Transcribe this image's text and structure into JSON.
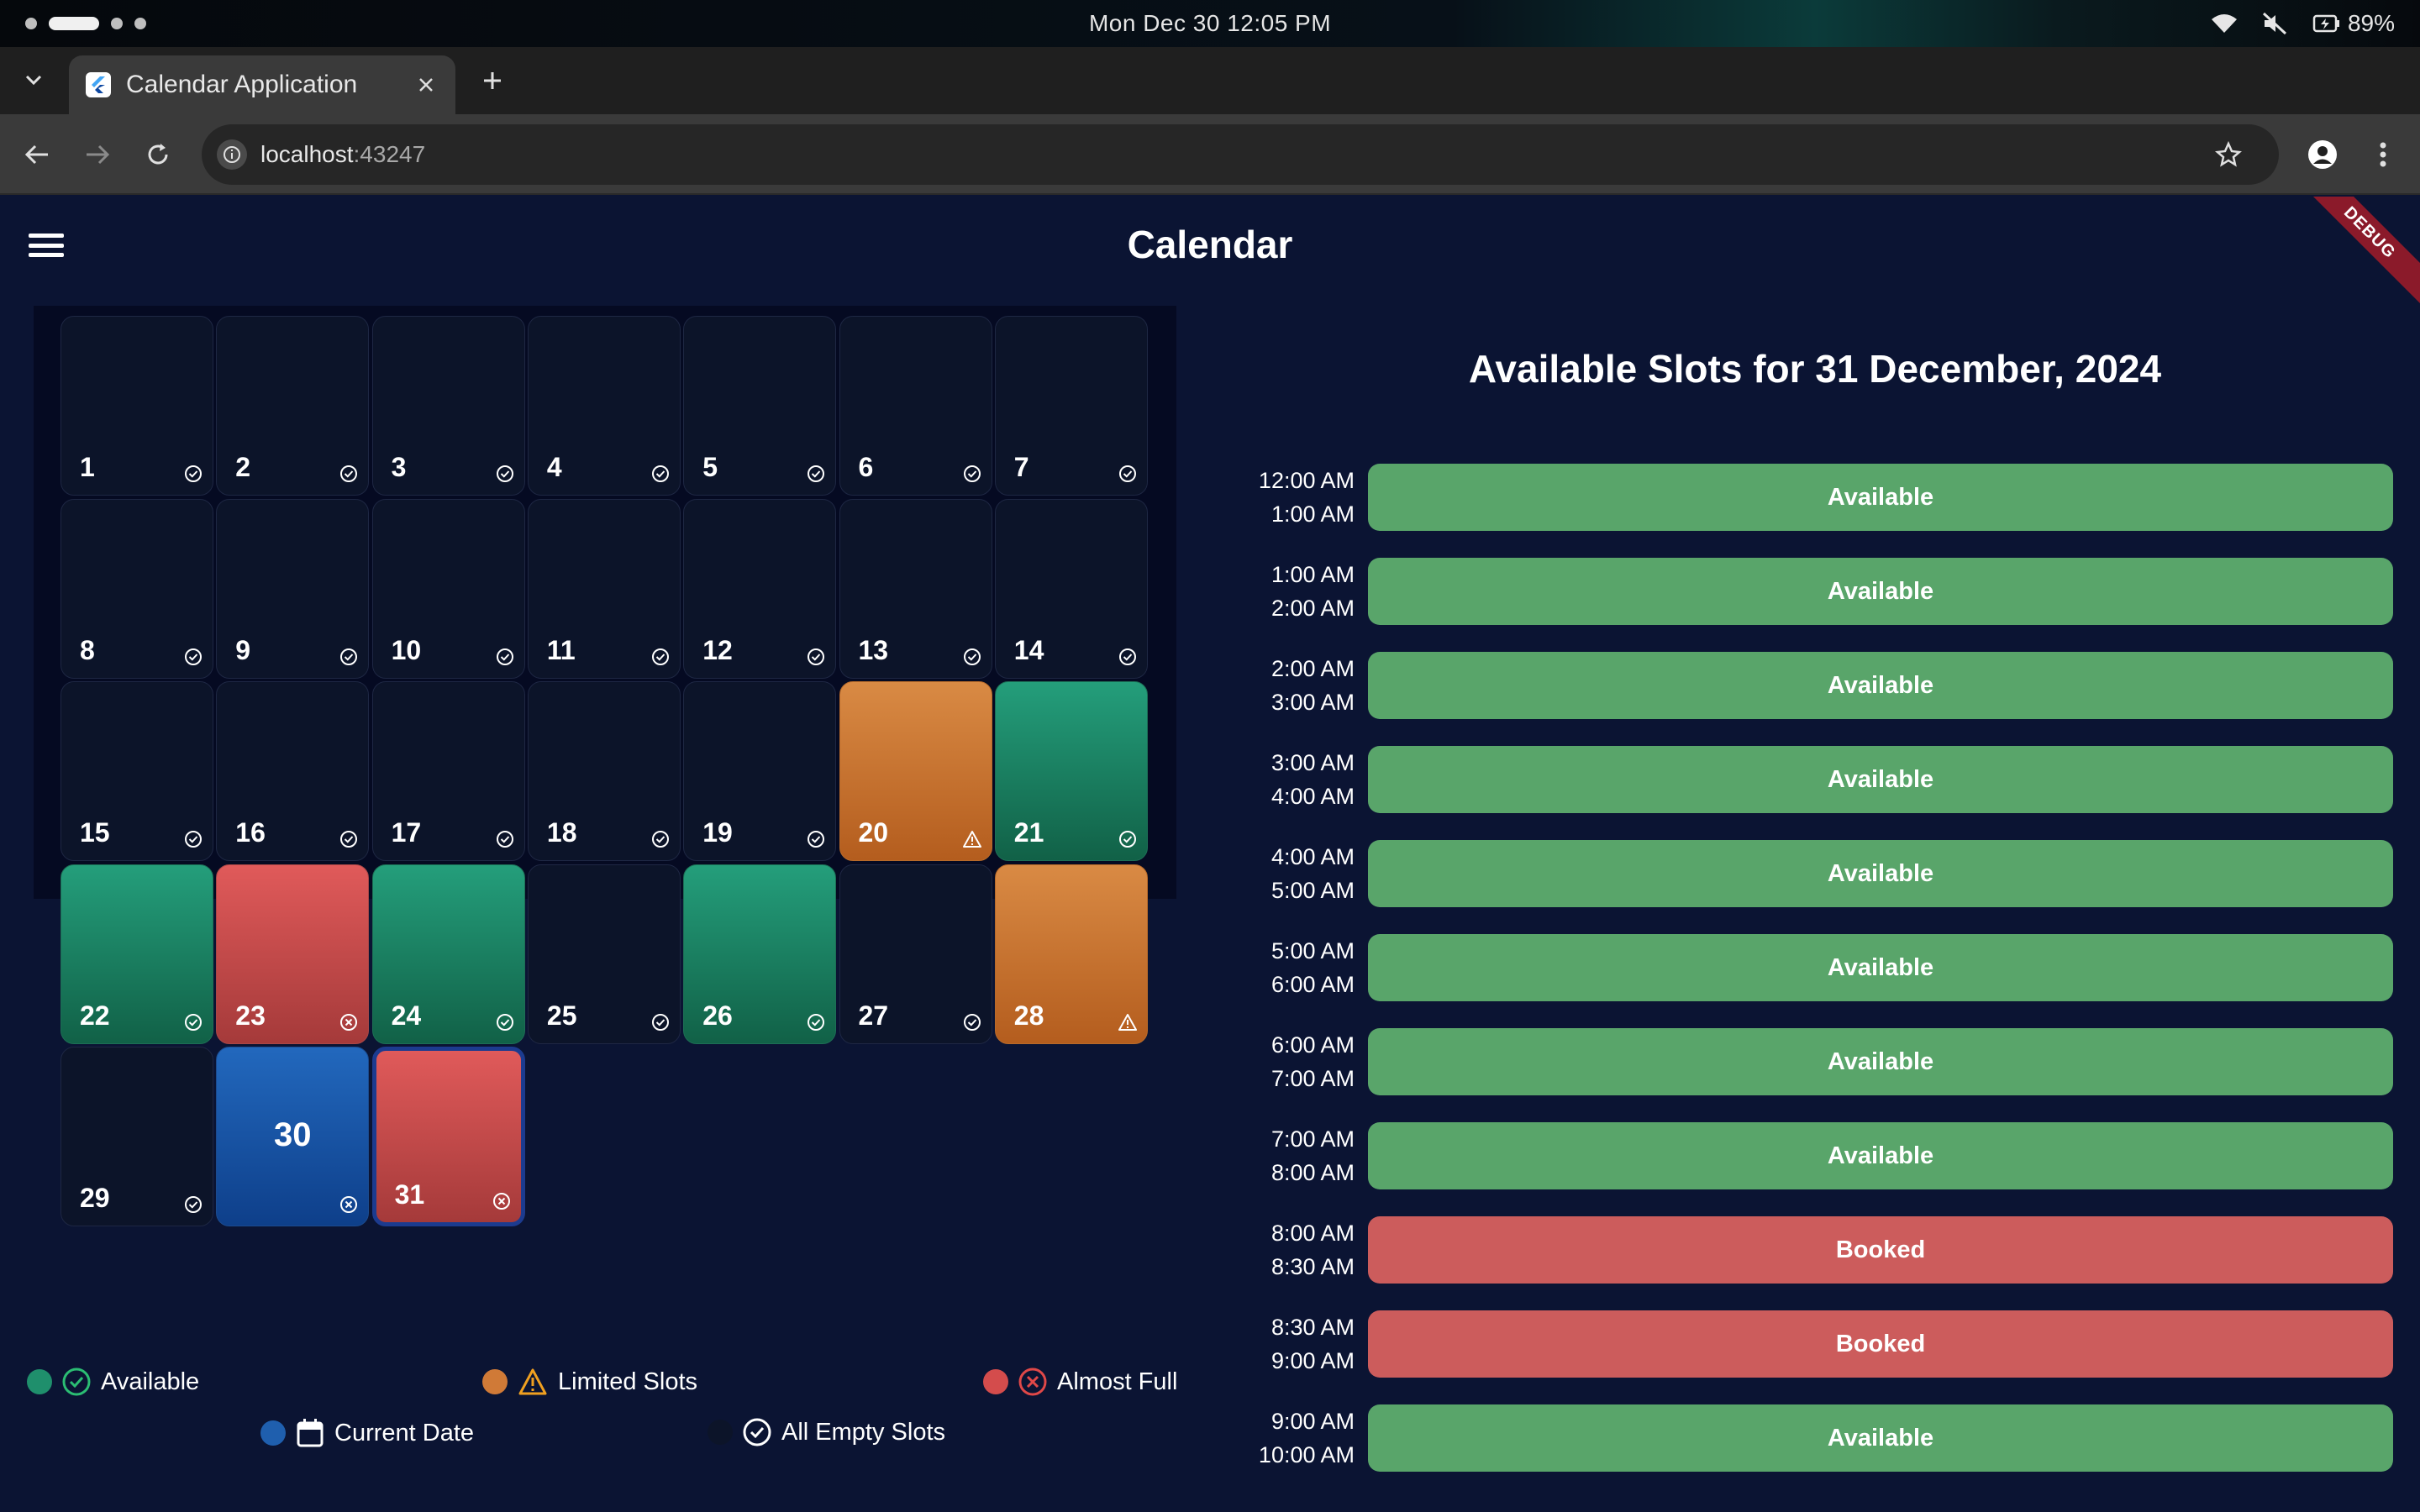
{
  "system_bar": {
    "clock": "Mon Dec 30  12:05 PM",
    "battery": "89%"
  },
  "browser": {
    "tab_title": "Calendar Application",
    "url_host": "localhost",
    "url_port": ":43247"
  },
  "app": {
    "title": "Calendar",
    "debug_label": "DEBUG"
  },
  "calendar": {
    "days": [
      {
        "day": "1",
        "status": "available",
        "color": "default"
      },
      {
        "day": "2",
        "status": "available",
        "color": "default"
      },
      {
        "day": "3",
        "status": "available",
        "color": "default"
      },
      {
        "day": "4",
        "status": "available",
        "color": "default"
      },
      {
        "day": "5",
        "status": "available",
        "color": "default"
      },
      {
        "day": "6",
        "status": "available",
        "color": "default"
      },
      {
        "day": "7",
        "status": "available",
        "color": "default"
      },
      {
        "day": "8",
        "status": "available",
        "color": "default"
      },
      {
        "day": "9",
        "status": "available",
        "color": "default"
      },
      {
        "day": "10",
        "status": "available",
        "color": "default"
      },
      {
        "day": "11",
        "status": "available",
        "color": "default"
      },
      {
        "day": "12",
        "status": "available",
        "color": "default"
      },
      {
        "day": "13",
        "status": "available",
        "color": "default"
      },
      {
        "day": "14",
        "status": "available",
        "color": "default"
      },
      {
        "day": "15",
        "status": "available",
        "color": "default"
      },
      {
        "day": "16",
        "status": "available",
        "color": "default"
      },
      {
        "day": "17",
        "status": "available",
        "color": "default"
      },
      {
        "day": "18",
        "status": "available",
        "color": "default"
      },
      {
        "day": "19",
        "status": "available",
        "color": "default"
      },
      {
        "day": "20",
        "status": "limited",
        "color": "orange"
      },
      {
        "day": "21",
        "status": "available",
        "color": "green"
      },
      {
        "day": "22",
        "status": "available",
        "color": "green"
      },
      {
        "day": "23",
        "status": "full",
        "color": "red"
      },
      {
        "day": "24",
        "status": "available",
        "color": "green"
      },
      {
        "day": "25",
        "status": "available",
        "color": "default"
      },
      {
        "day": "26",
        "status": "available",
        "color": "green"
      },
      {
        "day": "27",
        "status": "available",
        "color": "default"
      },
      {
        "day": "28",
        "status": "limited",
        "color": "orange"
      },
      {
        "day": "29",
        "status": "available",
        "color": "default"
      },
      {
        "day": "30",
        "status": "full",
        "color": "blue",
        "current": true
      },
      {
        "day": "31",
        "status": "full",
        "color": "red",
        "selected": true
      }
    ]
  },
  "legend": {
    "available": "Available",
    "limited": "Limited Slots",
    "almost_full": "Almost Full",
    "current_date": "Current Date",
    "all_empty": "All Empty Slots"
  },
  "colors": {
    "available": "#1f8f6c",
    "limited": "#d07a37",
    "almost_full": "#d44c4c",
    "current_date": "#1f5fae",
    "slot_available": "#59a56a",
    "slot_booked": "#cc5c5c"
  },
  "slots": {
    "title": "Available Slots for 31 December, 2024",
    "items": [
      {
        "start": "12:00 AM",
        "end": "1:00 AM",
        "status": "Available"
      },
      {
        "start": "1:00 AM",
        "end": "2:00 AM",
        "status": "Available"
      },
      {
        "start": "2:00 AM",
        "end": "3:00 AM",
        "status": "Available"
      },
      {
        "start": "3:00 AM",
        "end": "4:00 AM",
        "status": "Available"
      },
      {
        "start": "4:00 AM",
        "end": "5:00 AM",
        "status": "Available"
      },
      {
        "start": "5:00 AM",
        "end": "6:00 AM",
        "status": "Available"
      },
      {
        "start": "6:00 AM",
        "end": "7:00 AM",
        "status": "Available"
      },
      {
        "start": "7:00 AM",
        "end": "8:00 AM",
        "status": "Available"
      },
      {
        "start": "8:00 AM",
        "end": "8:30 AM",
        "status": "Booked"
      },
      {
        "start": "8:30 AM",
        "end": "9:00 AM",
        "status": "Booked"
      },
      {
        "start": "9:00 AM",
        "end": "10:00 AM",
        "status": "Available"
      }
    ]
  }
}
